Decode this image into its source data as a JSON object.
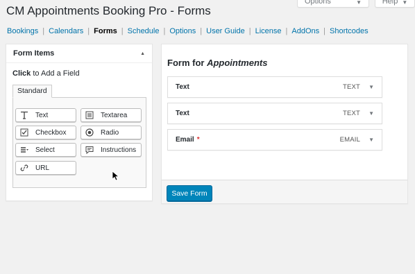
{
  "screen_meta": {
    "screen_options_label": "Screen Options",
    "help_label": "Help",
    "caret": "▼"
  },
  "page": {
    "title": "CM Appointments Booking Pro - Forms"
  },
  "subnav": {
    "items": [
      {
        "label": "Bookings"
      },
      {
        "label": "Calendars"
      },
      {
        "label": "Forms"
      },
      {
        "label": "Schedule"
      },
      {
        "label": "Options"
      },
      {
        "label": "User Guide"
      },
      {
        "label": "License"
      },
      {
        "label": "AddOns"
      },
      {
        "label": "Shortcodes"
      }
    ],
    "separator": "|",
    "active": "Forms"
  },
  "form_items": {
    "title": "Form Items",
    "toggle_icon": "▲",
    "hint_bold": "Click",
    "hint_rest": " to Add a Field",
    "tab_label": "Standard",
    "fields": [
      {
        "label": "Text",
        "icon": "text-icon"
      },
      {
        "label": "Textarea",
        "icon": "textarea-icon"
      },
      {
        "label": "Checkbox",
        "icon": "checkbox-icon"
      },
      {
        "label": "Radio",
        "icon": "radio-icon"
      },
      {
        "label": "Select",
        "icon": "select-icon"
      },
      {
        "label": "Instructions",
        "icon": "instructions-icon"
      },
      {
        "label": "URL",
        "icon": "link-icon"
      }
    ]
  },
  "form_editor": {
    "title_prefix": "Form for ",
    "title_name": "Appointments",
    "fields": [
      {
        "label": "Text",
        "required": "",
        "type": "TEXT"
      },
      {
        "label": "Text",
        "required": "",
        "type": "TEXT"
      },
      {
        "label": "Email",
        "required": "*",
        "type": "EMAIL"
      }
    ],
    "arrow": "▼",
    "save_label": "Save Form"
  },
  "colors": {
    "link": "#0073aa",
    "primary_button": "#0085ba",
    "required": "#dc3232"
  }
}
